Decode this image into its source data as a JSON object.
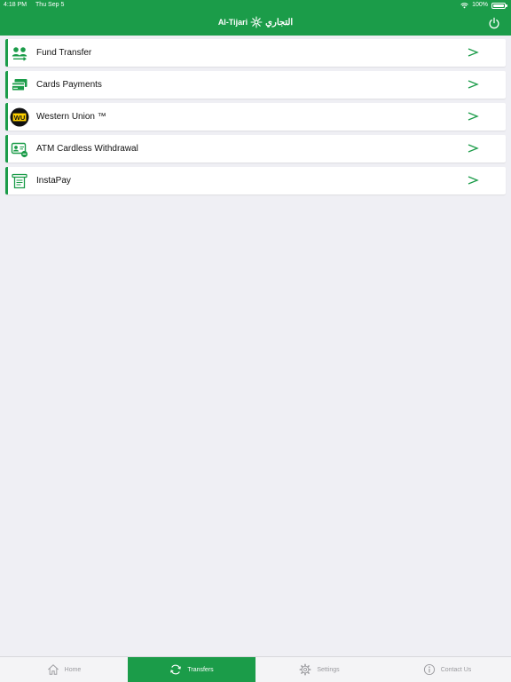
{
  "status_bar": {
    "time": "4:18 PM",
    "date": "Thu Sep 5",
    "battery": "100%"
  },
  "nav": {
    "logo_latin": "Al-Tijari",
    "logo_arabic": "التجاري"
  },
  "menu": [
    {
      "label": "Fund Transfer",
      "icon": "users-transfer-icon"
    },
    {
      "label": "Cards Payments",
      "icon": "credit-cards-icon"
    },
    {
      "label": "Western Union ™",
      "icon": "western-union-logo",
      "logo_text": "WU"
    },
    {
      "label": "ATM Cardless Withdrawal",
      "icon": "atm-id-card-icon"
    },
    {
      "label": "InstaPay",
      "icon": "receipt-icon"
    }
  ],
  "tabs": [
    {
      "label": "Home",
      "icon": "home-icon",
      "active": false
    },
    {
      "label": "Transfers",
      "icon": "refresh-arrows-icon",
      "active": true
    },
    {
      "label": "Settings",
      "icon": "gear-icon",
      "active": false
    },
    {
      "label": "Contact Us",
      "icon": "info-icon",
      "active": false
    }
  ],
  "colors": {
    "brand_green": "#1b9c49",
    "background": "#efeff4"
  }
}
